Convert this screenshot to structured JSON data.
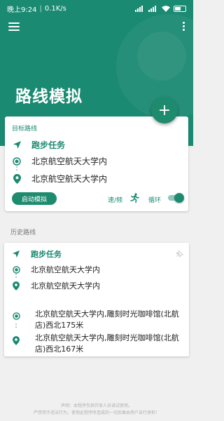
{
  "status_bar": {
    "time": "晚上9:24",
    "speed": "0.1K/s"
  },
  "header": {
    "title": "路线模拟"
  },
  "target_route": {
    "section_label": "目标路线",
    "task_name": "跑步任务",
    "start": "北京航空航天大学内",
    "end": "北京航空航天大学内",
    "start_button": "启动模拟",
    "speed_label": "速/频",
    "loop_label": "循环"
  },
  "history": {
    "section_label": "历史路线",
    "item1": {
      "task_name": "跑步任务",
      "start": "北京航空航天大学内",
      "end": "北京航空航天大学内"
    },
    "item2": {
      "start": "北京航空航天大学内,雕刻时光咖啡馆(北航店)西北175米",
      "end": "北京航空航天大学内,雕刻时光咖啡馆(北航店)西北167米"
    }
  },
  "disclaimer": {
    "line1": "声明：本程序仅供开发人员调试使用。",
    "line2": "严禁用于违法行为，使用此程序所造成的一切后果由用户自行承担！"
  },
  "colors": {
    "primary": "#1b8a72",
    "accent": "#1e8b6f"
  },
  "icons": [
    "menu-icon",
    "more-icon",
    "add-icon",
    "navigation-arrow-icon",
    "radio-target-icon",
    "location-pin-icon",
    "running-person-icon",
    "pin-icon"
  ]
}
